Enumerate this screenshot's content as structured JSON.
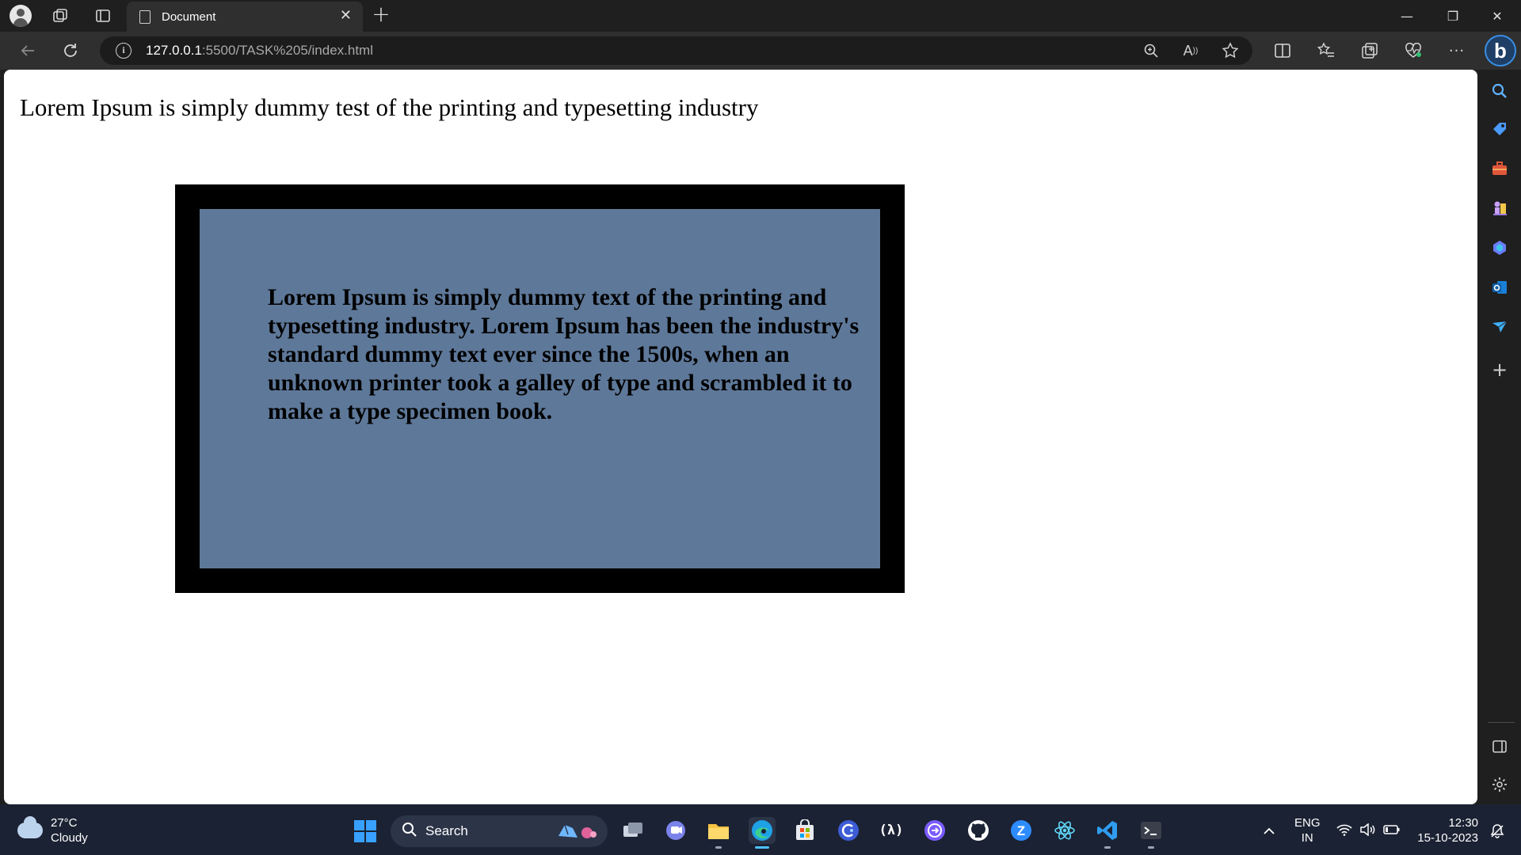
{
  "browser": {
    "tab_title": "Document",
    "tab_close": "✕",
    "new_tab": "+",
    "url_host": "127.0.0.1",
    "url_path": ":5500/TASK%205/index.html",
    "window_controls": {
      "minimize": "—",
      "restore": "❐",
      "close": "✕"
    },
    "bing_label": "b"
  },
  "page": {
    "heading": "Lorem Ipsum is simply dummy test of the printing and typesetting industry",
    "box_text": "Lorem Ipsum is simply dummy text of the printing and typesetting industry. Lorem Ipsum has been the industry's standard dummy text ever since the 1500s, when an unknown printer took a galley of type and scrambled it to make a type specimen book.",
    "colors": {
      "frame": "#000000",
      "inner": "#5e7899",
      "background": "#ffffff"
    }
  },
  "taskbar": {
    "weather_temp": "27°C",
    "weather_desc": "Cloudy",
    "search_label": "Search",
    "language": "ENG",
    "region": "IN",
    "time": "12:30",
    "date": "15-10-2023"
  },
  "icons": {
    "sidebar": [
      "search-icon",
      "tag-icon",
      "toolbox-icon",
      "chess-icon",
      "copilot-icon",
      "outlook-icon",
      "send-icon",
      "add-icon",
      "split-pane-icon",
      "settings-icon"
    ],
    "taskbar": [
      "windows-start-icon",
      "search-icon",
      "maps-icon",
      "task-view-icon",
      "teams-icon",
      "file-explorer-icon",
      "edge-icon",
      "store-icon",
      "app-c-icon",
      "app-lambda-icon",
      "app-arrow-icon",
      "github-icon",
      "zoom-icon",
      "react-icon",
      "vscode-icon",
      "terminal-icon"
    ]
  }
}
